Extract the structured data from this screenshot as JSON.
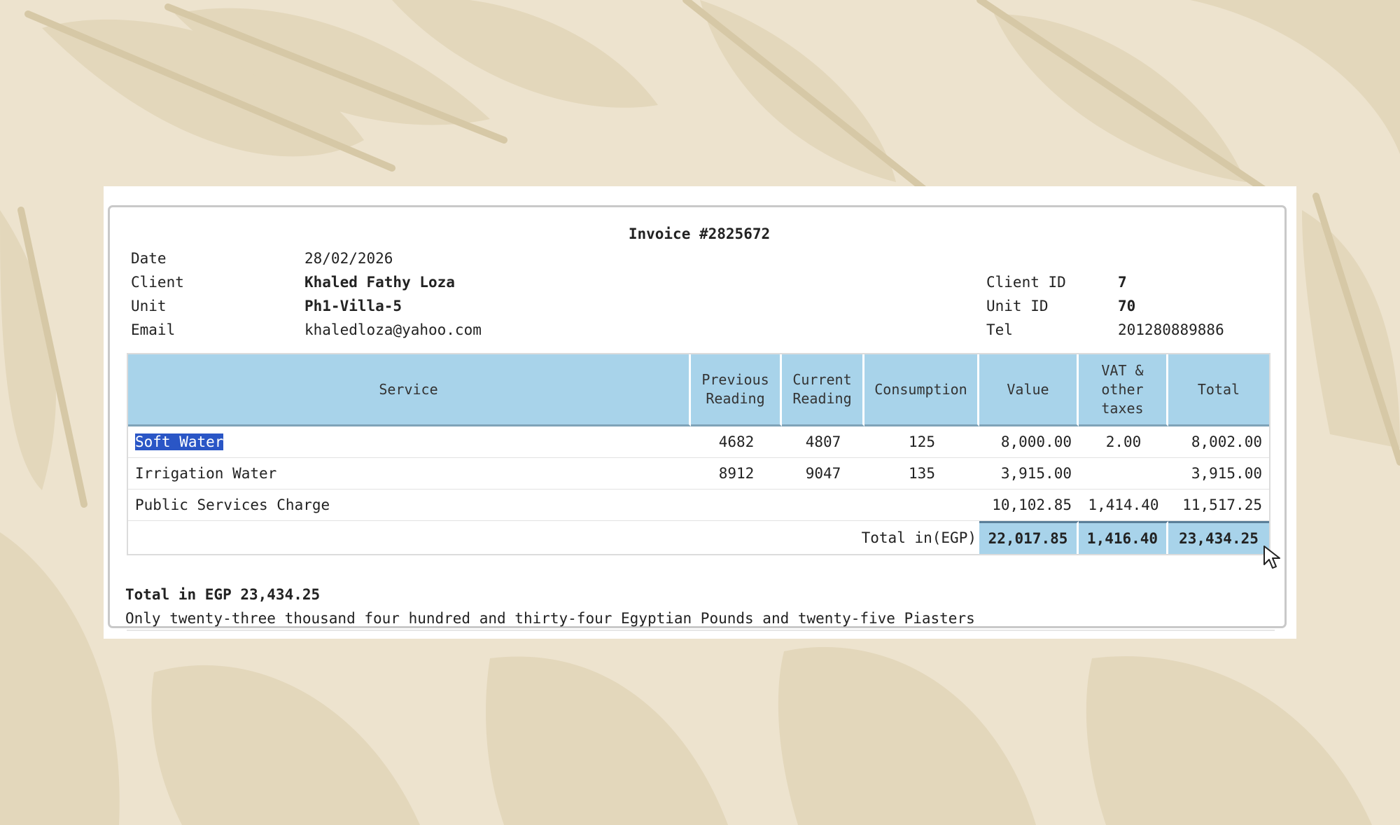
{
  "invoice": {
    "title": "Invoice #2825672",
    "fields_left": [
      {
        "label": "Date",
        "value": "28/02/2026",
        "bold": false
      },
      {
        "label": "Client",
        "value": "Khaled Fathy Loza",
        "bold": true
      },
      {
        "label": "Unit",
        "value": "Ph1-Villa-5",
        "bold": true
      },
      {
        "label": "Email",
        "value": "khaledloza@yahoo.com",
        "bold": false
      }
    ],
    "fields_right": [
      {
        "label": "Client ID",
        "value": "7",
        "bold": true
      },
      {
        "label": "Unit ID",
        "value": "70",
        "bold": true
      },
      {
        "label": "Tel",
        "value": "201280889886",
        "bold": false
      }
    ]
  },
  "table": {
    "headers": {
      "service": "Service",
      "previous_1": "Previous",
      "previous_2": "Reading",
      "current_1": "Current",
      "current_2": "Reading",
      "consumption": "Consumption",
      "value": "Value",
      "vat_1": "VAT &",
      "vat_2": "other",
      "vat_3": "taxes",
      "total": "Total"
    },
    "rows": [
      {
        "service": "Soft Water",
        "previous": "4682",
        "current": "4807",
        "consumption": "125",
        "value": "8,000.00",
        "vat": "2.00",
        "total": "8,002.00"
      },
      {
        "service": "Irrigation Water",
        "previous": "8912",
        "current": "9047",
        "consumption": "135",
        "value": "3,915.00",
        "vat": "",
        "total": "3,915.00"
      },
      {
        "service": "Public Services Charge",
        "previous": "",
        "current": "",
        "consumption": "",
        "value": "10,102.85",
        "vat": "1,414.40",
        "total": "11,517.25"
      }
    ],
    "totals": {
      "label": "Total in(EGP)",
      "value": "22,017.85",
      "vat": "1,416.40",
      "total": "23,434.25"
    }
  },
  "summary": {
    "total_line": "Total in EGP 23,434.25",
    "words_line": "Only twenty-three thousand four hundred and thirty-four Egyptian Pounds and twenty-five Piasters"
  },
  "colors": {
    "background": "#ede3ce",
    "leaf": "#e4d8bc",
    "header_blue": "#a8d3ea",
    "selection": "#2a56c6"
  },
  "icons": {
    "cursor": "mouse-pointer-icon"
  }
}
